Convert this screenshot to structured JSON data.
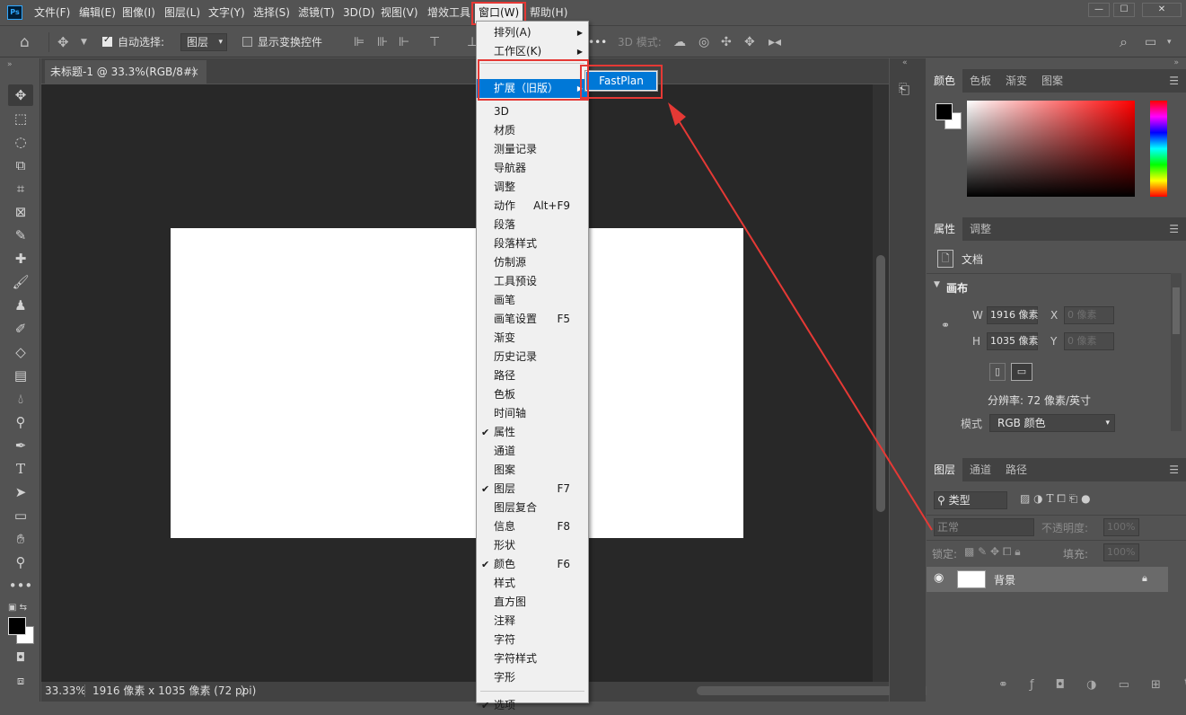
{
  "app": {
    "logo": "Ps"
  },
  "menubar": {
    "items": [
      "文件(F)",
      "编辑(E)",
      "图像(I)",
      "图层(L)",
      "文字(Y)",
      "选择(S)",
      "滤镜(T)",
      "3D(D)",
      "视图(V)",
      "增效工具",
      "窗口(W)",
      "帮助(H)"
    ],
    "window_controls": [
      "—",
      "☐",
      "✕"
    ]
  },
  "options": {
    "auto_select_label": "自动选择:",
    "auto_select_value": "图层",
    "show_transform_label": "显示变换控件",
    "mode_3d_label": "3D 模式:",
    "more": "•••"
  },
  "tools": [
    "move-tool",
    "marquee-tool",
    "lasso-tool",
    "object-select-tool",
    "crop-tool",
    "frame-tool",
    "eyedropper-tool",
    "healing-tool",
    "brush-tool",
    "stamp-tool",
    "history-brush-tool",
    "eraser-tool",
    "gradient-tool",
    "blur-tool",
    "dodge-tool",
    "pen-tool",
    "type-tool",
    "path-select-tool",
    "shape-tool",
    "hand-tool",
    "zoom-tool",
    "more-tools"
  ],
  "document": {
    "tab_title": "未标题-1 @ 33.3%(RGB/8#)",
    "tab_close": "×"
  },
  "status": {
    "zoom": "33.33%",
    "info": "1916 像素 x 1035 像素 (72 ppi)",
    "arrow": "〉"
  },
  "window_menu": {
    "items": [
      {
        "label": "排列(A)",
        "submenu": true
      },
      {
        "label": "工作区(K)",
        "submenu": true
      },
      {
        "label": "扩展（旧版）",
        "submenu": true,
        "highlighted": true
      },
      {
        "label": "3D"
      },
      {
        "label": "材质"
      },
      {
        "label": "测量记录"
      },
      {
        "label": "导航器"
      },
      {
        "label": "调整"
      },
      {
        "label": "动作",
        "shortcut": "Alt+F9"
      },
      {
        "label": "段落"
      },
      {
        "label": "段落样式"
      },
      {
        "label": "仿制源"
      },
      {
        "label": "工具预设"
      },
      {
        "label": "画笔"
      },
      {
        "label": "画笔设置",
        "shortcut": "F5"
      },
      {
        "label": "渐变"
      },
      {
        "label": "历史记录"
      },
      {
        "label": "路径"
      },
      {
        "label": "色板"
      },
      {
        "label": "时间轴"
      },
      {
        "label": "属性",
        "checked": true
      },
      {
        "label": "通道"
      },
      {
        "label": "图案"
      },
      {
        "label": "图层",
        "checked": true,
        "shortcut": "F7"
      },
      {
        "label": "图层复合"
      },
      {
        "label": "信息",
        "shortcut": "F8"
      },
      {
        "label": "形状"
      },
      {
        "label": "颜色",
        "checked": true,
        "shortcut": "F6"
      },
      {
        "label": "样式"
      },
      {
        "label": "直方图"
      },
      {
        "label": "注释"
      },
      {
        "label": "字符"
      },
      {
        "label": "字符样式"
      },
      {
        "label": "字形"
      },
      {
        "label": "选项",
        "checked": true
      }
    ],
    "extension_submenu": [
      "FastPlan"
    ]
  },
  "color_panel": {
    "tabs": [
      "颜色",
      "色板",
      "渐变",
      "图案"
    ],
    "foreground": "#000000",
    "background": "#ffffff"
  },
  "properties_panel": {
    "tabs": [
      "属性",
      "调整"
    ],
    "doc_label": "文档",
    "canvas_section": "画布",
    "w_label": "W",
    "w_value": "1916 像素",
    "h_label": "H",
    "h_value": "1035 像素",
    "x_label": "X",
    "x_value": "0 像素",
    "y_label": "Y",
    "y_value": "0 像素",
    "resolution": "分辨率: 72 像素/英寸",
    "mode_label": "模式",
    "mode_value": "RGB 颜色"
  },
  "layers_panel": {
    "tabs": [
      "图层",
      "通道",
      "路径"
    ],
    "filter_label": "类型",
    "blend_mode": "正常",
    "opacity_label": "不透明度:",
    "opacity_value": "100%",
    "lock_label": "锁定:",
    "fill_label": "填充:",
    "fill_value": "100%",
    "layers": [
      {
        "name": "背景",
        "locked": true,
        "visible": true
      }
    ]
  },
  "colors": {
    "accent": "#0078d7",
    "annotation": "#e53935"
  }
}
